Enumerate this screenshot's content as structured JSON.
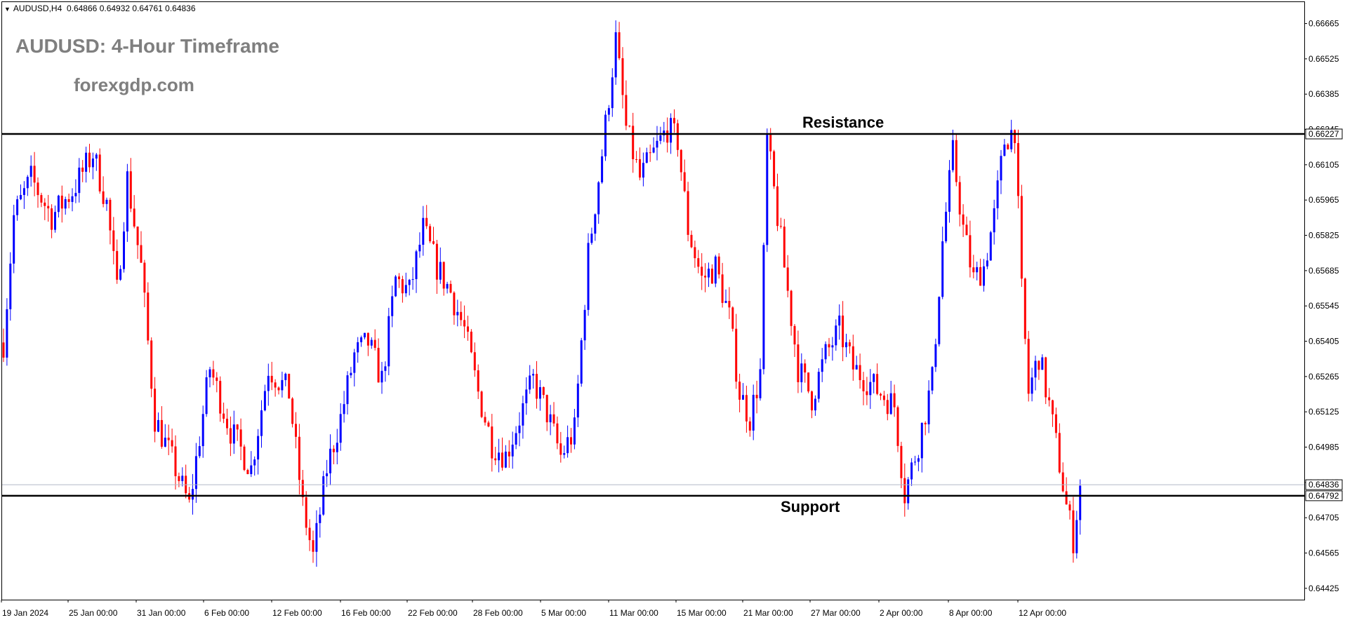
{
  "header": {
    "symbol": "AUDUSD,H4",
    "open": "0.64866",
    "high": "0.64932",
    "low": "0.64761",
    "close": "0.64836"
  },
  "overlay_title": "AUDUSD: 4-Hour Timeframe",
  "overlay_site": "forexgdp.com",
  "chart_data": {
    "type": "candlestick",
    "symbol": "AUDUSD",
    "timeframe": "H4",
    "ylim": [
      0.6438,
      0.6675
    ],
    "y_ticks": [
      "0.66665",
      "0.66525",
      "0.66385",
      "0.66245",
      "0.66105",
      "0.65965",
      "0.65825",
      "0.65685",
      "0.65545",
      "0.65405",
      "0.65265",
      "0.65125",
      "0.64985",
      "0.64845",
      "0.64705",
      "0.64565",
      "0.64425"
    ],
    "x_ticks": [
      "19 Jan 2024",
      "25 Jan 00:00",
      "31 Jan 00:00",
      "6 Feb 00:00",
      "12 Feb 00:00",
      "16 Feb 00:00",
      "22 Feb 00:00",
      "28 Feb 00:00",
      "5 Mar 00:00",
      "11 Mar 00:00",
      "15 Mar 00:00",
      "21 Mar 00:00",
      "27 Mar 00:00",
      "2 Apr 00:00",
      "8 Apr 00:00",
      "12 Apr 00:00"
    ],
    "levels": [
      {
        "name": "Resistance",
        "price": 0.66227,
        "label": "0.66227"
      },
      {
        "name": "Support",
        "price": 0.64792,
        "label": "0.64792"
      }
    ],
    "current_price": {
      "price": 0.64836,
      "label": "0.64836"
    },
    "colors": {
      "bull": "#0000ff",
      "bear": "#ff0000",
      "level": "#000000",
      "current": "#b0b8c8"
    },
    "candles": {
      "start_price": 0.654,
      "anchors": [
        [
          0,
          0.654
        ],
        [
          3,
          0.659
        ],
        [
          8,
          0.6605
        ],
        [
          14,
          0.659
        ],
        [
          20,
          0.66
        ],
        [
          26,
          0.6615
        ],
        [
          30,
          0.6595
        ],
        [
          33,
          0.656
        ],
        [
          36,
          0.6605
        ],
        [
          40,
          0.657
        ],
        [
          44,
          0.651
        ],
        [
          50,
          0.649
        ],
        [
          54,
          0.6475
        ],
        [
          60,
          0.653
        ],
        [
          66,
          0.6505
        ],
        [
          72,
          0.649
        ],
        [
          77,
          0.653
        ],
        [
          83,
          0.652
        ],
        [
          87,
          0.6475
        ],
        [
          90,
          0.6455
        ],
        [
          94,
          0.649
        ],
        [
          98,
          0.651
        ],
        [
          102,
          0.6535
        ],
        [
          106,
          0.654
        ],
        [
          110,
          0.6525
        ],
        [
          114,
          0.6565
        ],
        [
          118,
          0.656
        ],
        [
          122,
          0.6585
        ],
        [
          126,
          0.657
        ],
        [
          130,
          0.656
        ],
        [
          134,
          0.6545
        ],
        [
          138,
          0.652
        ],
        [
          142,
          0.65
        ],
        [
          146,
          0.6495
        ],
        [
          150,
          0.651
        ],
        [
          154,
          0.6525
        ],
        [
          158,
          0.6512
        ],
        [
          162,
          0.6495
        ],
        [
          166,
          0.6505
        ],
        [
          170,
          0.6575
        ],
        [
          174,
          0.6615
        ],
        [
          178,
          0.666
        ],
        [
          181,
          0.6625
        ],
        [
          185,
          0.6605
        ],
        [
          189,
          0.6615
        ],
        [
          193,
          0.6625
        ],
        [
          196,
          0.662
        ],
        [
          199,
          0.6585
        ],
        [
          203,
          0.6565
        ],
        [
          207,
          0.657
        ],
        [
          211,
          0.655
        ],
        [
          214,
          0.652
        ],
        [
          217,
          0.651
        ],
        [
          220,
          0.6528
        ],
        [
          222,
          0.662
        ],
        [
          224,
          0.66
        ],
        [
          227,
          0.657
        ],
        [
          231,
          0.653
        ],
        [
          235,
          0.6518
        ],
        [
          239,
          0.6535
        ],
        [
          243,
          0.6545
        ],
        [
          247,
          0.653
        ],
        [
          251,
          0.6525
        ],
        [
          255,
          0.652
        ],
        [
          259,
          0.6515
        ],
        [
          262,
          0.648
        ],
        [
          266,
          0.65
        ],
        [
          270,
          0.6525
        ],
        [
          273,
          0.658
        ],
        [
          276,
          0.6615
        ],
        [
          279,
          0.6585
        ],
        [
          282,
          0.6565
        ],
        [
          285,
          0.657
        ],
        [
          288,
          0.659
        ],
        [
          291,
          0.662
        ],
        [
          294,
          0.6625
        ],
        [
          296,
          0.656
        ],
        [
          298,
          0.652
        ],
        [
          301,
          0.6535
        ],
        [
          304,
          0.6515
        ],
        [
          307,
          0.6492
        ],
        [
          309,
          0.6475
        ],
        [
          311,
          0.6462
        ],
        [
          313,
          0.6483
        ]
      ]
    }
  }
}
